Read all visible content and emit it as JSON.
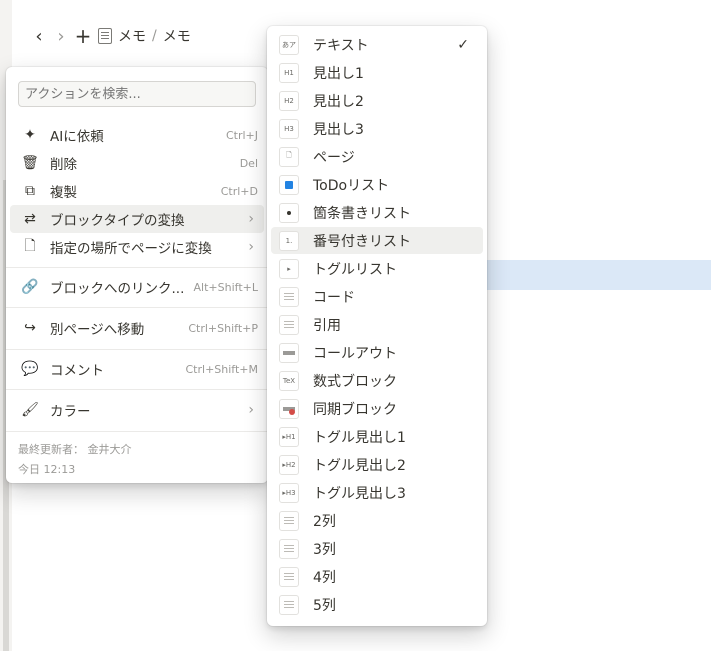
{
  "topbar": {
    "breadcrumb": [
      "メモ",
      "メモ"
    ],
    "separator": "/"
  },
  "action_menu": {
    "search_placeholder": "アクションを検索...",
    "items": [
      {
        "label": "AIに依頼",
        "shortcut": "Ctrl+J",
        "icon": "sparkle-icon"
      },
      {
        "label": "削除",
        "shortcut": "Del",
        "icon": "trash-icon"
      },
      {
        "label": "複製",
        "shortcut": "Ctrl+D",
        "icon": "duplicate-icon"
      },
      {
        "label": "ブロックタイプの変換",
        "shortcut": "",
        "icon": "turn-into-icon",
        "submenu": true,
        "active": true
      },
      {
        "label": "指定の場所でページに変換",
        "shortcut": "",
        "icon": "page-icon",
        "submenu": true
      },
      {
        "label": "ブロックへのリンク...",
        "shortcut": "Alt+Shift+L",
        "icon": "link-icon"
      },
      {
        "label": "別ページへ移動",
        "shortcut": "Ctrl+Shift+P",
        "icon": "move-icon"
      },
      {
        "label": "コメント",
        "shortcut": "Ctrl+Shift+M",
        "icon": "comment-icon"
      },
      {
        "label": "カラー",
        "shortcut": "",
        "icon": "paint-roller-icon",
        "submenu": true
      }
    ],
    "footer": {
      "edited_by": "最終更新者： 金井大介",
      "edited_time": "今日 12:13"
    }
  },
  "turn_into_menu": {
    "items": [
      {
        "label": "テキスト",
        "thumb": "あア",
        "checked": true
      },
      {
        "label": "見出し1",
        "thumb": "H1"
      },
      {
        "label": "見出し2",
        "thumb": "H2"
      },
      {
        "label": "見出し3",
        "thumb": "H3"
      },
      {
        "label": "ページ",
        "thumb": "page"
      },
      {
        "label": "ToDoリスト",
        "thumb": "todo"
      },
      {
        "label": "箇条書きリスト",
        "thumb": "bullet"
      },
      {
        "label": "番号付きリスト",
        "thumb": "1.",
        "active": true
      },
      {
        "label": "トグルリスト",
        "thumb": "toggle"
      },
      {
        "label": "コード",
        "thumb": "code"
      },
      {
        "label": "引用",
        "thumb": "quote"
      },
      {
        "label": "コールアウト",
        "thumb": "callout"
      },
      {
        "label": "数式ブロック",
        "thumb": "TeX"
      },
      {
        "label": "同期ブロック",
        "thumb": "sync"
      },
      {
        "label": "トグル見出し1",
        "thumb": "▸H1"
      },
      {
        "label": "トグル見出し2",
        "thumb": "▸H2"
      },
      {
        "label": "トグル見出し3",
        "thumb": "▸H3"
      },
      {
        "label": "2列",
        "thumb": "cols"
      },
      {
        "label": "3列",
        "thumb": "cols"
      },
      {
        "label": "4列",
        "thumb": "cols"
      },
      {
        "label": "5列",
        "thumb": "cols"
      }
    ]
  },
  "colors": {
    "selection_highlight": "#dbe8f7",
    "hover_bg": "#efefed",
    "text": "#37352f",
    "muted": "#9b9a97"
  }
}
